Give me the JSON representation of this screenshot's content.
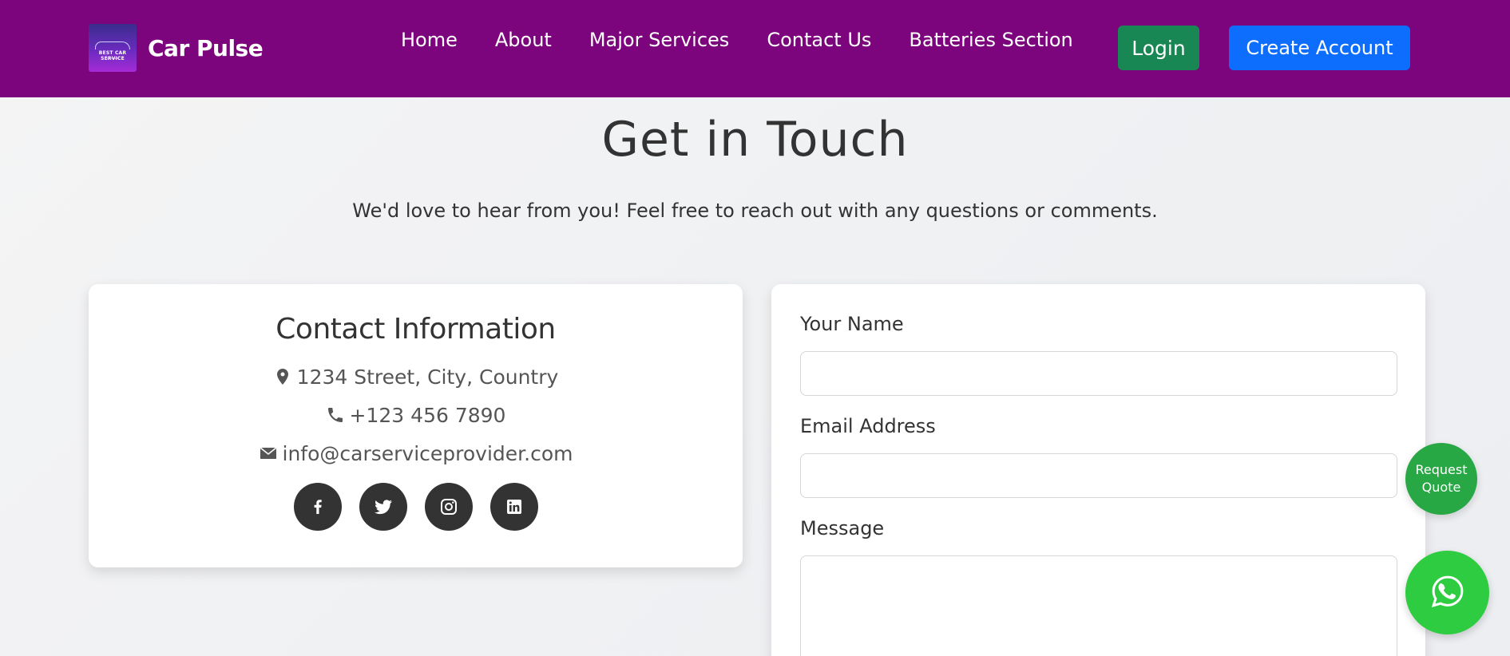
{
  "brand": {
    "name": "Car Pulse",
    "logo_text": "BEST CAR SERVICE",
    "logo_sub": "IN TOWN"
  },
  "nav": {
    "links": [
      "Home",
      "About",
      "Major Services",
      "Contact Us",
      "Batteries Section"
    ],
    "login_label": "Login",
    "create_account_label": "Create Account"
  },
  "hero": {
    "title": "Get in Touch",
    "subtitle": "We'd love to hear from you! Feel free to reach out with any questions or comments."
  },
  "contact": {
    "title": "Contact Information",
    "address": "1234 Street, City, Country",
    "phone": "+123 456 7890",
    "email": "info@carserviceprovider.com",
    "socials": [
      "facebook-icon",
      "twitter-icon",
      "instagram-icon",
      "linkedin-icon"
    ]
  },
  "form": {
    "name_label": "Your Name",
    "name_value": "",
    "email_label": "Email Address",
    "email_value": "",
    "message_label": "Message",
    "message_value": ""
  },
  "floating": {
    "quote_label": "Request Quote",
    "whatsapp_icon": "whatsapp-icon"
  },
  "colors": {
    "navbar": "#7c047c",
    "login": "#198754",
    "create_account": "#0d6efd",
    "quote": "#28a745",
    "whatsapp": "#2ecc40"
  }
}
